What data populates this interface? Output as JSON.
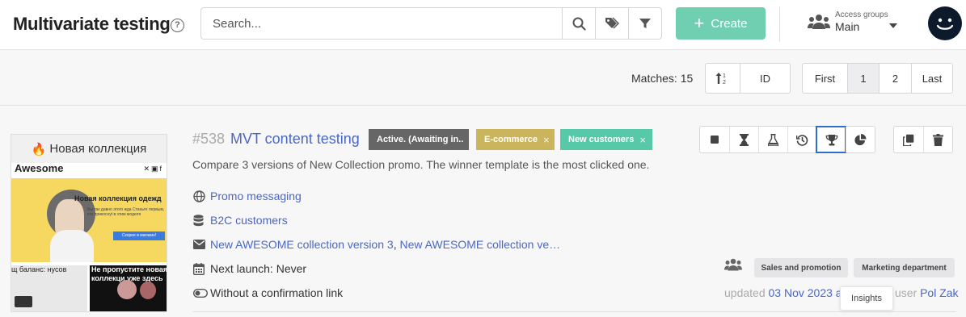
{
  "header": {
    "title": "Multivariate testing",
    "help_icon": "?",
    "search_placeholder": "Search...",
    "create_label": "Create",
    "access_label": "Access groups",
    "access_value": "Main"
  },
  "toolbar": {
    "matches": "Matches: 15",
    "sort_by": "ID",
    "pages": [
      "First",
      "1",
      "2",
      "Last"
    ],
    "current_page": "1"
  },
  "item": {
    "id": "#538",
    "name": "MVT content testing",
    "status_tag": "Active. (Awaiting in..",
    "tags": [
      "E-commerce",
      "New customers"
    ],
    "tag_remove": "×",
    "description": "Compare 3 versions of New Collection promo. The winner template is the most clicked one.",
    "category": "Promo messaging",
    "segment": "B2C customers",
    "message_1": "New AWESOME collection version 3",
    "message_sep": ", ",
    "message_2": "New AWESOME collection ve…",
    "next_launch": "Next launch: Never",
    "confirmation": "Without a confirmation link",
    "access_groups": [
      "Sales and promotion",
      "Marketing department"
    ],
    "updated_prefix": "updated ",
    "updated_date": "03 Nov 2023 at 09:54",
    "updated_by": " by user ",
    "updated_user": "Pol Zak",
    "tooltip": "Insights"
  },
  "thumbnail": {
    "header": "Новая коллекция",
    "brand": "Awesome",
    "hero_title": "Новая коллекция одежд",
    "hero_sub": "Вы так давно этого жда Станьте первым, кто прикоснуt в этим моделя",
    "hero_button": "Скорее в магазин!",
    "left_text": "щ баланс: нусов",
    "right_text": "Не пропустите новая коллекци уже здесь"
  },
  "colors": {
    "create": "#6fcfb0",
    "link": "#4a67c4",
    "status_tag": "#666666",
    "tag_ecommerce": "#cbb55c",
    "tag_new_customers": "#58c9a8",
    "focus_outline": "#2b6fcf"
  },
  "icons": {
    "action_buttons": [
      "stop-icon",
      "hourglass-icon",
      "flask-icon",
      "history-icon",
      "trophy-icon",
      "pie-chart-icon"
    ],
    "secondary_buttons": [
      "copy-icon",
      "trash-icon"
    ]
  }
}
